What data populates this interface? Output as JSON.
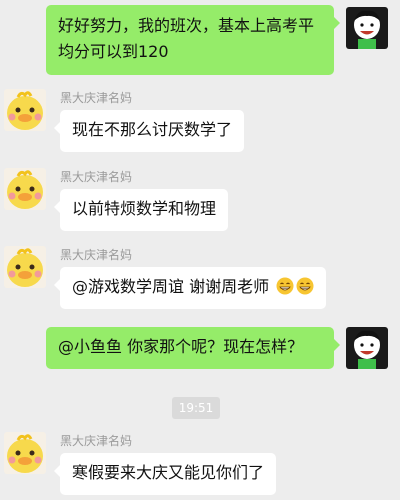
{
  "messages": [
    {
      "side": "right",
      "text": "好好努力，我的班次，基本上高考平均分可以到120"
    },
    {
      "side": "left",
      "sender": "黑大庆津名妈",
      "text": "现在不那么讨厌数学了"
    },
    {
      "side": "left",
      "sender": "黑大庆津名妈",
      "text": "以前特烦数学和物理"
    },
    {
      "side": "left",
      "sender": "黑大庆津名妈",
      "text": "@游戏数学周谊 谢谢周老师",
      "emojis": [
        "grin-emoji",
        "grin-emoji"
      ]
    },
    {
      "side": "right",
      "text": "@小鱼鱼 你家那个呢？现在怎样？"
    },
    {
      "side": "left",
      "sender": "黑大庆津名妈",
      "text": "寒假要来大庆又能见你们了"
    }
  ],
  "timestamp": "19:51",
  "colors": {
    "background": "#ededed",
    "right_bubble": "#95ec69",
    "left_bubble": "#ffffff",
    "name_text": "#9a9a9a"
  },
  "icons": {
    "self_avatar": "cartoon-face-avatar",
    "other_avatar": "yellow-duck-avatar",
    "emoji": "grin-emoji"
  }
}
